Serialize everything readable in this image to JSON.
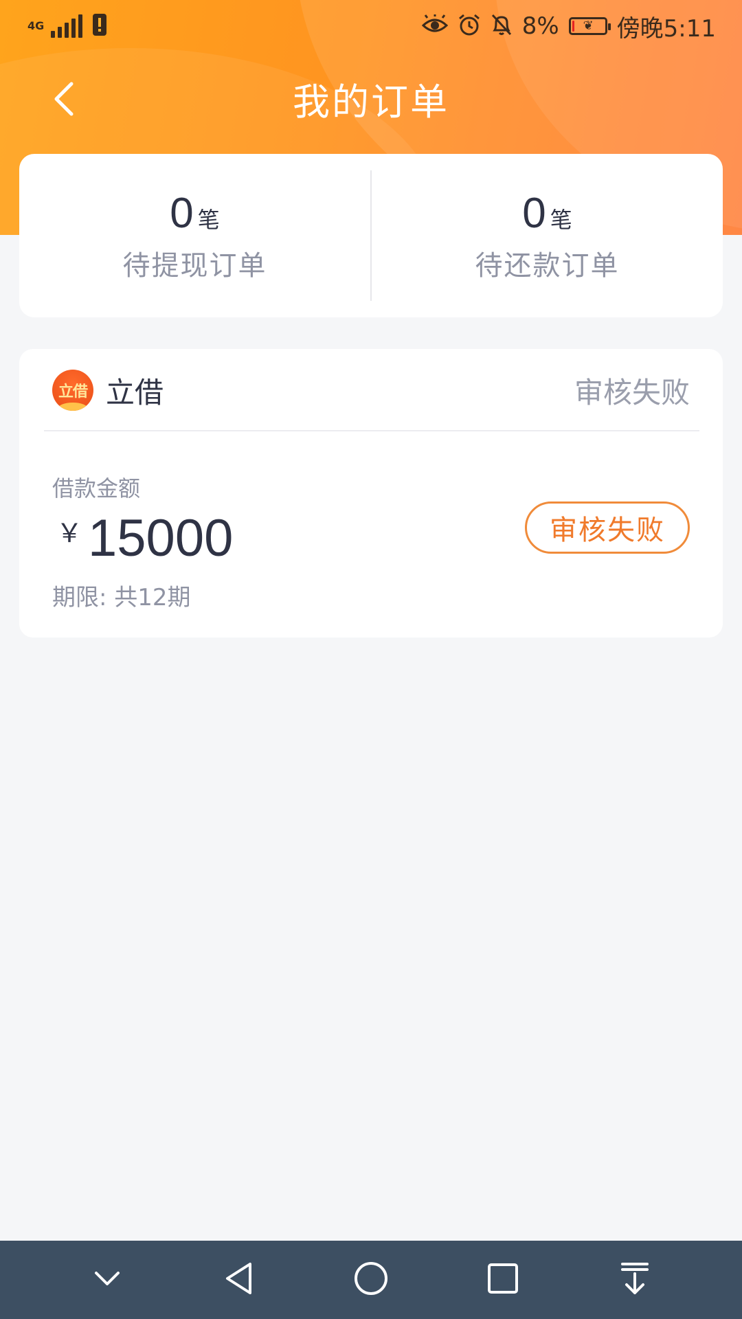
{
  "status_bar": {
    "network": "4G",
    "battery_percent": "8%",
    "time": "傍晚5:11",
    "icons": [
      "signal-icon",
      "sim-alert-icon",
      "eye-comfort-icon",
      "alarm-icon",
      "mute-icon",
      "battery-icon"
    ]
  },
  "header": {
    "title": "我的订单",
    "back_icon": "chevron-left-icon"
  },
  "stats": [
    {
      "count": "0",
      "unit": "笔",
      "label": "待提现订单"
    },
    {
      "count": "0",
      "unit": "笔",
      "label": "待还款订单"
    }
  ],
  "order": {
    "brand_logo_text": "立借",
    "brand_name": "立借",
    "status": "审核失败",
    "amount_label": "借款金额",
    "currency": "￥",
    "amount": "15000",
    "term": "期限: 共12期",
    "status_button": "审核失败"
  },
  "nav_bar": {
    "buttons": [
      "collapse-icon",
      "back-triangle-icon",
      "home-circle-icon",
      "recents-square-icon",
      "download-icon"
    ]
  },
  "colors": {
    "header_gradient_start": "#ffa41c",
    "header_gradient_end": "#ff7a30",
    "accent_orange": "#f07a2b",
    "nav_bar": "#3d4f62",
    "background": "#f5f6f8"
  }
}
